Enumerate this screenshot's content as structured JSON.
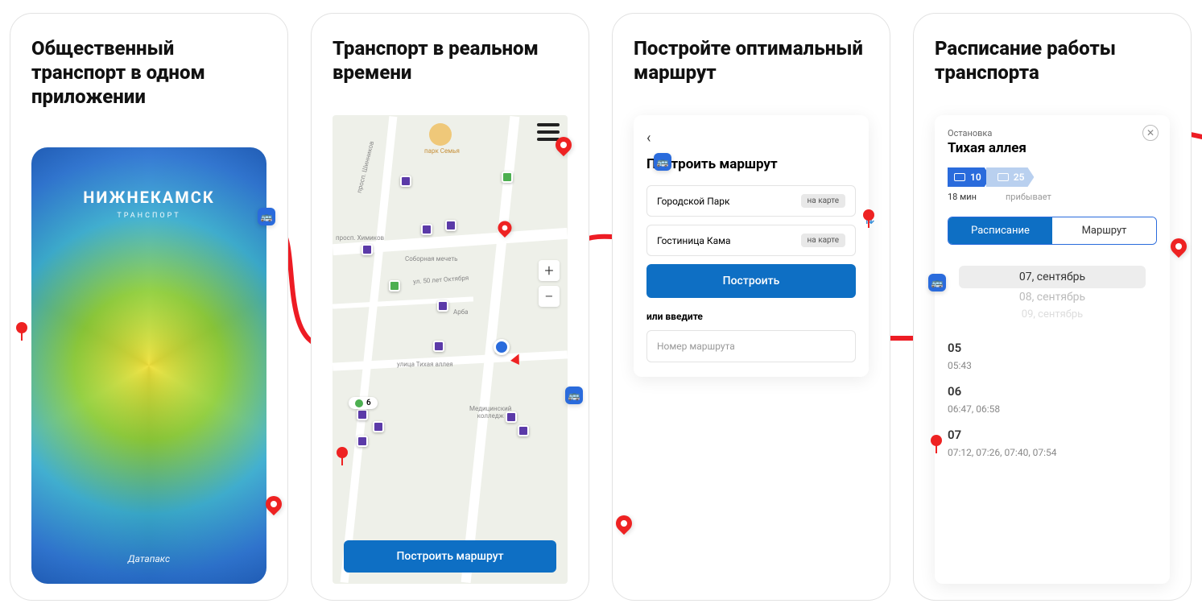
{
  "panel1": {
    "title": "Общественный транспорт в одном приложении",
    "splash_city": "НИЖНЕКАМСК",
    "splash_sub": "ТРАНСПОРТ",
    "splash_logo": "Датапакс"
  },
  "panel2": {
    "title": "Транспорт в реальном времени",
    "park_label": "парк Семья",
    "build_route_btn": "Построить маршрут",
    "route6": "6"
  },
  "panel3": {
    "title": "Постройте оптимальный маршрут",
    "card_title": "Построить маршрут",
    "from": "Городской Парк",
    "to": "Гостиница Кама",
    "on_map": "на карте",
    "build_btn": "Построить",
    "or_enter": "или введите",
    "route_number_placeholder": "Номер маршрута"
  },
  "panel4": {
    "title": "Расписание работы транспорта",
    "stop_label": "Остановка",
    "stop_name": "Тихая аллея",
    "route_a": "10",
    "route_b": "25",
    "eta": "18 мин",
    "arriving": "прибывает",
    "tab_schedule": "Расписание",
    "tab_route": "Маршрут",
    "date_active": "07, сентябрь",
    "date_next": "08, сентябрь",
    "date_faded": "09, сентябрь",
    "hour1": "05",
    "times1": "05:43",
    "hour2": "06",
    "times2": "06:47, 06:58",
    "hour3": "07",
    "times3": "07:12, 07:26, 07:40, 07:54"
  }
}
